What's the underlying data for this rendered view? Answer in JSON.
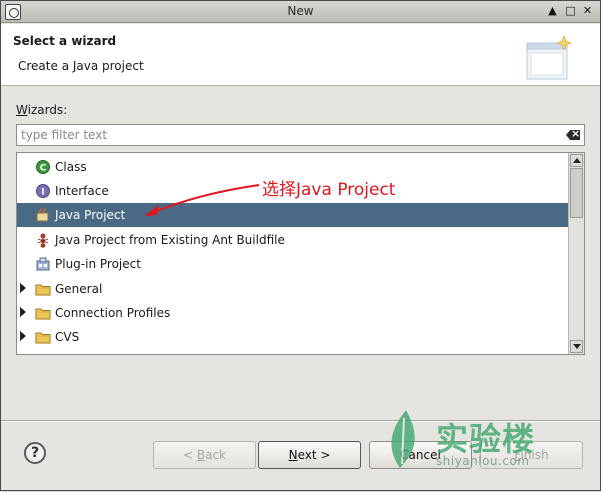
{
  "window": {
    "title": "New"
  },
  "header": {
    "title": "Select a wizard",
    "subtitle": "Create a Java project"
  },
  "wizards_label_prefix": "W",
  "wizards_label_rest": "izards:",
  "filter": {
    "placeholder": "type filter text",
    "value": ""
  },
  "tree": {
    "items": [
      {
        "label": "Class",
        "icon": "class-icon",
        "expandable": false,
        "selected": false
      },
      {
        "label": "Interface",
        "icon": "interface-icon",
        "expandable": false,
        "selected": false
      },
      {
        "label": "Java Project",
        "icon": "java-project-icon",
        "expandable": false,
        "selected": true
      },
      {
        "label": "Java Project from Existing Ant Buildfile",
        "icon": "ant-icon",
        "expandable": false,
        "selected": false
      },
      {
        "label": "Plug-in Project",
        "icon": "plugin-project-icon",
        "expandable": false,
        "selected": false
      },
      {
        "label": "General",
        "icon": "folder-icon",
        "expandable": true,
        "selected": false
      },
      {
        "label": "Connection Profiles",
        "icon": "folder-icon",
        "expandable": true,
        "selected": false
      },
      {
        "label": "CVS",
        "icon": "folder-icon",
        "expandable": true,
        "selected": false
      }
    ]
  },
  "annotation": {
    "text": "选择Java Project",
    "color": "#e0161c"
  },
  "buttons": {
    "back_prefix": "< ",
    "back_mnemonic": "B",
    "back_rest": "ack",
    "next_mnemonic": "N",
    "next_rest": "ext >",
    "cancel": "Cancel",
    "finish_mnemonic": "F",
    "finish_rest": "inish",
    "help": "?"
  },
  "watermark": {
    "cn": "实验楼",
    "en": "shiyanlou.com"
  },
  "colors": {
    "selection": "#4a6984",
    "header_bg": "#ffffff",
    "dialog_bg": "#e6e4e0"
  }
}
